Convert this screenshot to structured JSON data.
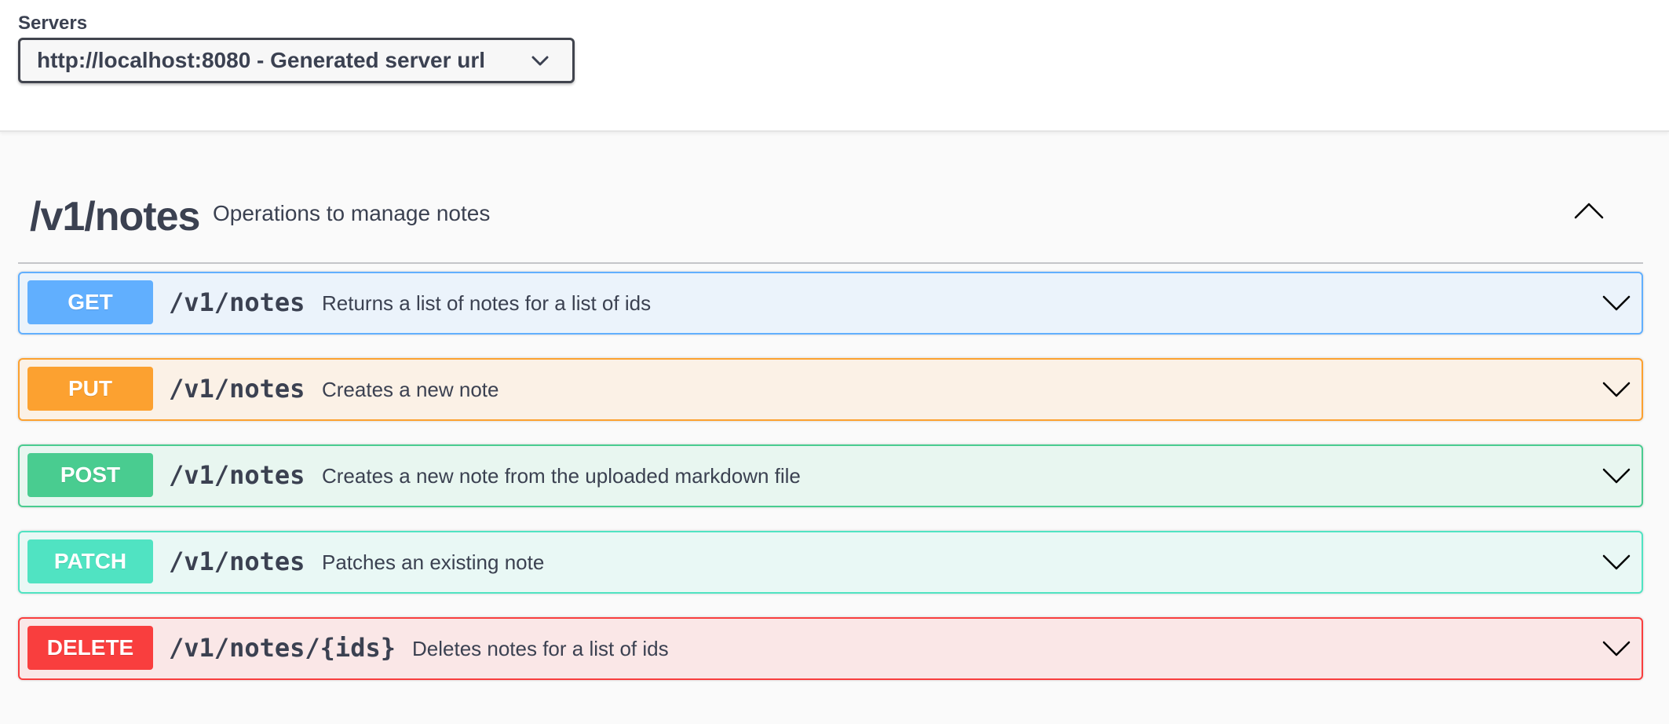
{
  "servers": {
    "label": "Servers",
    "selected": "http://localhost:8080 - Generated server url"
  },
  "tag": {
    "name": "/v1/notes",
    "description": "Operations to manage notes",
    "expanded": true
  },
  "operations": [
    {
      "method": "GET",
      "path": "/v1/notes",
      "summary": "Returns a list of notes for a list of ids",
      "color": "#61affe"
    },
    {
      "method": "PUT",
      "path": "/v1/notes",
      "summary": "Creates a new note",
      "color": "#fca130"
    },
    {
      "method": "POST",
      "path": "/v1/notes",
      "summary": "Creates a new note from the uploaded markdown file",
      "color": "#49cc90"
    },
    {
      "method": "PATCH",
      "path": "/v1/notes",
      "summary": "Patches an existing note",
      "color": "#50e3c2"
    },
    {
      "method": "DELETE",
      "path": "/v1/notes/{ids}",
      "summary": "Deletes notes for a list of ids",
      "color": "#f93e3e"
    }
  ],
  "icons": {
    "server_dropdown": "chevron-down-icon",
    "tag_toggle": "chevron-up-icon",
    "operation_toggle": "chevron-down-icon"
  }
}
